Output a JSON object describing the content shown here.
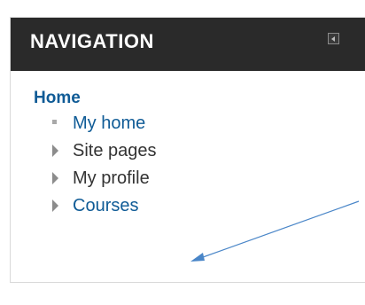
{
  "navigation_block": {
    "title": "NAVIGATION",
    "dock_icon": "dock-collapse-icon",
    "home": {
      "label": "Home"
    },
    "items": [
      {
        "label": "My home",
        "icon": "square-bullet-icon",
        "style": "link"
      },
      {
        "label": "Site pages",
        "icon": "expand-triangle-icon",
        "style": "plain"
      },
      {
        "label": "My profile",
        "icon": "expand-triangle-icon",
        "style": "plain"
      },
      {
        "label": "Courses",
        "icon": "expand-triangle-icon",
        "style": "link"
      }
    ]
  },
  "annotation": {
    "icon": "annotation-arrow",
    "color": "#4a86c8",
    "points_to": "Courses"
  },
  "colors": {
    "header_bg": "#2a2a2a",
    "link": "#0f5b96",
    "text": "#333333"
  }
}
